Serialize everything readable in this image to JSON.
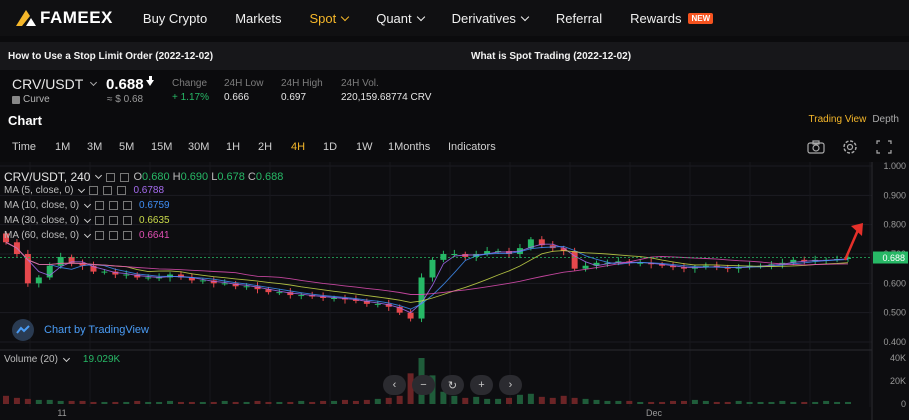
{
  "brand": {
    "name": "FAMEEX"
  },
  "nav": {
    "items": [
      {
        "label": "Buy Crypto",
        "dropdown": false
      },
      {
        "label": "Markets",
        "dropdown": false
      },
      {
        "label": "Spot",
        "dropdown": true,
        "active": true
      },
      {
        "label": "Quant",
        "dropdown": true
      },
      {
        "label": "Derivatives",
        "dropdown": true
      },
      {
        "label": "Referral",
        "dropdown": false
      },
      {
        "label": "Rewards",
        "dropdown": false,
        "badge": "NEW"
      }
    ]
  },
  "news": [
    "How to Use a Stop Limit Order (2022-12-02)",
    "What is Spot Trading (2022-12-02)"
  ],
  "ticker": {
    "pair": "CRV/USDT",
    "coin": "Curve",
    "price": "0.688",
    "usd": "≈ $ 0.68",
    "stats": [
      {
        "label": "Change",
        "value": "+ 1.17%",
        "up": true
      },
      {
        "label": "24H Low",
        "value": "0.666"
      },
      {
        "label": "24H High",
        "value": "0.697"
      },
      {
        "label": "24H Vol.",
        "value": "220,159.68774 CRV"
      }
    ]
  },
  "chart_header": {
    "title": "Chart",
    "trading_view": "Trading View",
    "depth": "Depth"
  },
  "toolbar": {
    "intervals": [
      "Time",
      "1M",
      "3M",
      "5M",
      "15M",
      "30M",
      "1H",
      "2H",
      "4H",
      "1D",
      "1W",
      "1Months",
      "Indicators"
    ],
    "active": "4H"
  },
  "legend": {
    "symbol": "CRV/USDT, 240",
    "ohlc": {
      "o": "0.680",
      "h": "0.690",
      "l": "0.678",
      "c": "0.688"
    },
    "ma": [
      {
        "label": "MA (5, close, 0)",
        "value": "0.6788",
        "color": "#a66cf0"
      },
      {
        "label": "MA (10, close, 0)",
        "value": "0.6759",
        "color": "#3f8ef5"
      },
      {
        "label": "MA (30, close, 0)",
        "value": "0.6635",
        "color": "#c9d94a"
      },
      {
        "label": "MA (60, close, 0)",
        "value": "0.6641",
        "color": "#e04fb4"
      }
    ],
    "volume": {
      "label": "Volume (20)",
      "value": "19.029K"
    }
  },
  "tv_credit": "Chart by TradingView",
  "colors": {
    "up": "#27b866",
    "down": "#e5484d",
    "accent": "#f5b72a"
  },
  "chart_data": {
    "type": "candlestick",
    "y_axis": {
      "ticks": [
        "1.000",
        "0.900",
        "0.800",
        "0.700",
        "0.600",
        "0.500",
        "0.400"
      ],
      "range": [
        0.4,
        1.0
      ]
    },
    "volume_axis": {
      "ticks": [
        "40K",
        "20K",
        "0"
      ]
    },
    "x_ticks": [
      "11",
      "Dec"
    ],
    "last_price": "0.688",
    "close_series": [
      0.74,
      0.7,
      0.6,
      0.62,
      0.66,
      0.69,
      0.67,
      0.66,
      0.64,
      0.64,
      0.63,
      0.63,
      0.62,
      0.62,
      0.62,
      0.63,
      0.62,
      0.61,
      0.61,
      0.6,
      0.6,
      0.59,
      0.59,
      0.58,
      0.57,
      0.57,
      0.56,
      0.56,
      0.555,
      0.55,
      0.55,
      0.545,
      0.54,
      0.53,
      0.53,
      0.52,
      0.5,
      0.48,
      0.62,
      0.68,
      0.7,
      0.7,
      0.69,
      0.7,
      0.71,
      0.71,
      0.7,
      0.72,
      0.75,
      0.73,
      0.72,
      0.71,
      0.65,
      0.66,
      0.67,
      0.67,
      0.675,
      0.67,
      0.67,
      0.665,
      0.66,
      0.655,
      0.65,
      0.655,
      0.66,
      0.655,
      0.65,
      0.655,
      0.66,
      0.66,
      0.665,
      0.67,
      0.68,
      0.675,
      0.68,
      0.68,
      0.683,
      0.688
    ],
    "volume_series": [
      8,
      6,
      5,
      4,
      4,
      3,
      3,
      3,
      2,
      2,
      2,
      2,
      3,
      2,
      2,
      3,
      2,
      2,
      2,
      2,
      3,
      2,
      2,
      3,
      2,
      2,
      2,
      3,
      2,
      3,
      3,
      4,
      3,
      4,
      5,
      6,
      8,
      30,
      45,
      28,
      12,
      8,
      6,
      7,
      5,
      5,
      6,
      9,
      10,
      7,
      6,
      8,
      6,
      5,
      4,
      3,
      3,
      3,
      2,
      2,
      2,
      3,
      3,
      4,
      3,
      2,
      2,
      3,
      2,
      2,
      2,
      3,
      2,
      2,
      2,
      3,
      2,
      2
    ]
  }
}
